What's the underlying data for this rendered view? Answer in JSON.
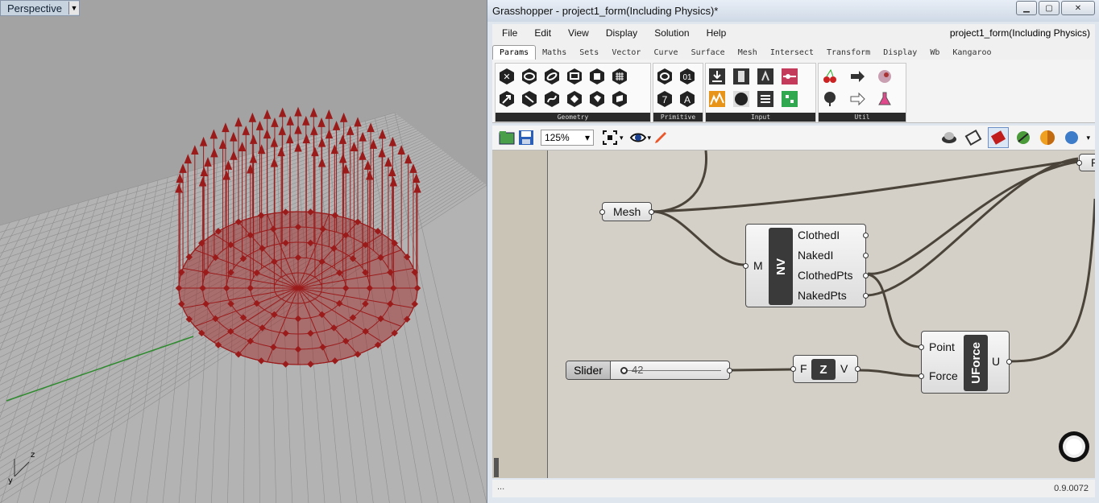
{
  "viewport": {
    "label": "Perspective",
    "axis_labels": {
      "z": "z",
      "y": "y"
    }
  },
  "window": {
    "title": "Grasshopper - project1_form(Including Physics)*",
    "document_name": "project1_form(Including Physics)",
    "buttons": [
      "minimize",
      "maximize",
      "close"
    ]
  },
  "menu": [
    "File",
    "Edit",
    "View",
    "Display",
    "Solution",
    "Help"
  ],
  "tabs": [
    "Params",
    "Maths",
    "Sets",
    "Vector",
    "Curve",
    "Surface",
    "Mesh",
    "Intersect",
    "Transform",
    "Display",
    "Wb",
    "Kangaroo"
  ],
  "active_tab": "Params",
  "ribbon_panels": [
    "Geometry",
    "Primitive",
    "Input",
    "Util"
  ],
  "zoom": "125%",
  "canvas": {
    "mesh_param": "Mesh",
    "nv": {
      "name": "NV",
      "input": "M",
      "outputs": [
        "ClothedI",
        "NakedI",
        "ClothedPts",
        "NakedPts"
      ]
    },
    "slider": {
      "label": "Slider",
      "value": "42"
    },
    "vector_z": {
      "name": "Z",
      "input": "F",
      "output": "V"
    },
    "uforce": {
      "name": "UForce",
      "inputs": [
        "Point",
        "Force"
      ],
      "output": "U"
    },
    "edge_param": "P"
  },
  "status": {
    "left": "...",
    "version": "0.9.0072"
  },
  "colors": {
    "accent": "#9b1b1b",
    "canvas_bg": "#d4d0c8",
    "component_dark": "#3a3a3a"
  }
}
